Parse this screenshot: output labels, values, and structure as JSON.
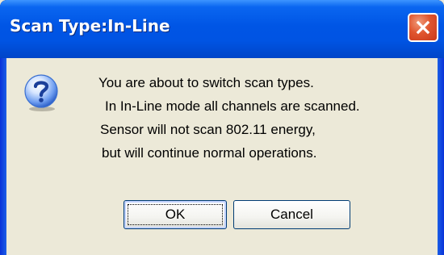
{
  "window": {
    "title": "Scan Type:In-Line"
  },
  "dialog": {
    "icon": "question-icon",
    "message_lines": [
      "You are about to switch scan types.",
      "In In-Line mode all channels are scanned.",
      "Sensor will not scan 802.11 energy,",
      "but will continue normal operations."
    ]
  },
  "buttons": {
    "ok_label": "OK",
    "cancel_label": "Cancel"
  },
  "colors": {
    "titlebar": "#0054e3",
    "close_button": "#e0552e",
    "dialog_background": "#ece9d8"
  }
}
